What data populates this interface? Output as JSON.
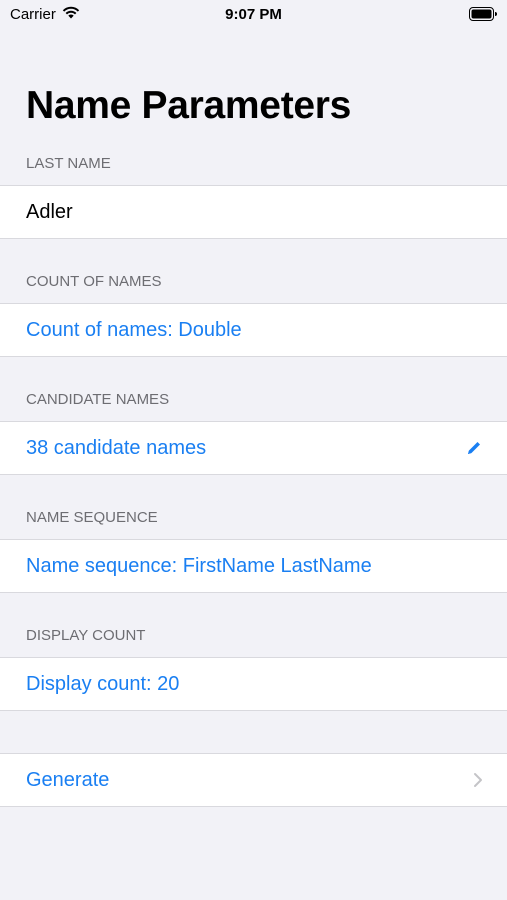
{
  "status_bar": {
    "carrier": "Carrier",
    "time": "9:07 PM",
    "wifi_icon": "wifi-icon",
    "battery_icon": "battery-icon"
  },
  "page_title": "Name Parameters",
  "sections": [
    {
      "header": "LAST NAME",
      "value": "Adler"
    },
    {
      "header": "COUNT OF NAMES",
      "value": "Count of names: Double"
    },
    {
      "header": "CANDIDATE NAMES",
      "value": "38 candidate names",
      "accessory_icon": "pencil-icon"
    },
    {
      "header": "NAME SEQUENCE",
      "value": "Name sequence: FirstName LastName"
    },
    {
      "header": "DISPLAY COUNT",
      "value": "Display count: 20"
    },
    {
      "header": "",
      "value": "Generate",
      "accessory_icon": "chevron-right-icon"
    }
  ],
  "colors": {
    "tint": "#1a7ff2",
    "background": "#f2f2f7",
    "header_text": "#6d6d72"
  }
}
